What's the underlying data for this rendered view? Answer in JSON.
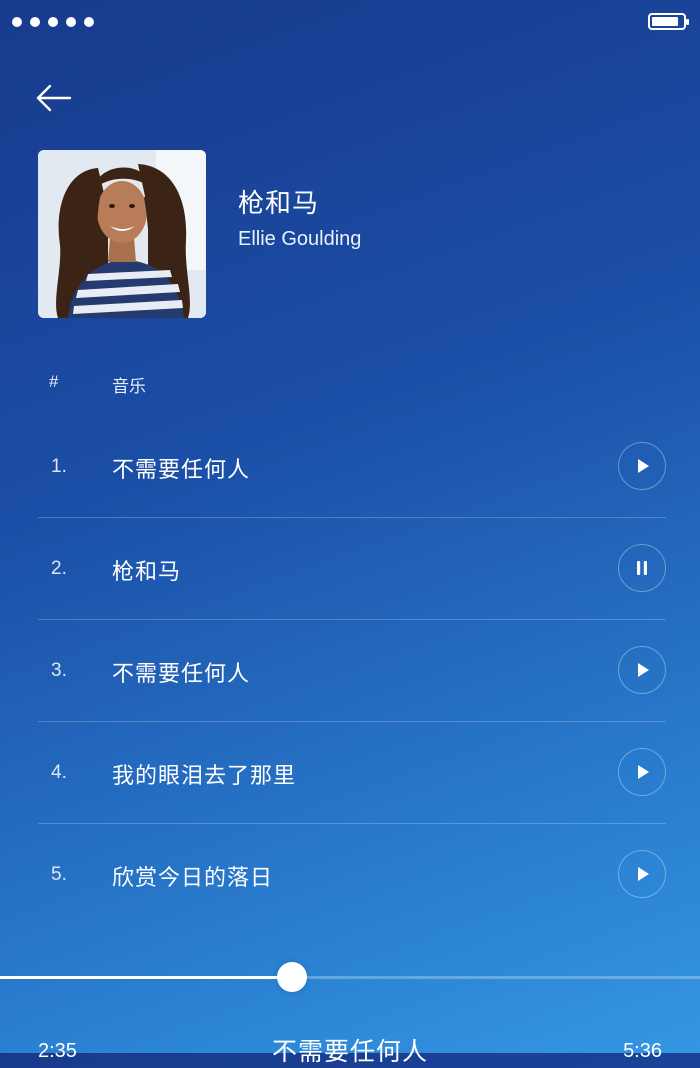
{
  "status_bar": {
    "signal_dots": 5,
    "battery_level": 0.8
  },
  "album": {
    "title": "枪和马",
    "artist": "Ellie Goulding"
  },
  "list_header": {
    "number_label": "#",
    "title_label": "音乐"
  },
  "tracks": [
    {
      "number": "1.",
      "title": "不需要任何人",
      "state": "play"
    },
    {
      "number": "2.",
      "title": "枪和马",
      "state": "pause"
    },
    {
      "number": "3.",
      "title": "不需要任何人",
      "state": "play"
    },
    {
      "number": "4.",
      "title": "我的眼泪去了那里",
      "state": "play"
    },
    {
      "number": "5.",
      "title": "欣赏今日的落日",
      "state": "play"
    }
  ],
  "player": {
    "elapsed": "2:35",
    "total": "5:36",
    "now_playing": "不需要任何人",
    "progress": 0.417
  },
  "colors": {
    "background_top": "#183a8c",
    "background_bottom": "#3596e3",
    "accent": "#ffffff"
  }
}
